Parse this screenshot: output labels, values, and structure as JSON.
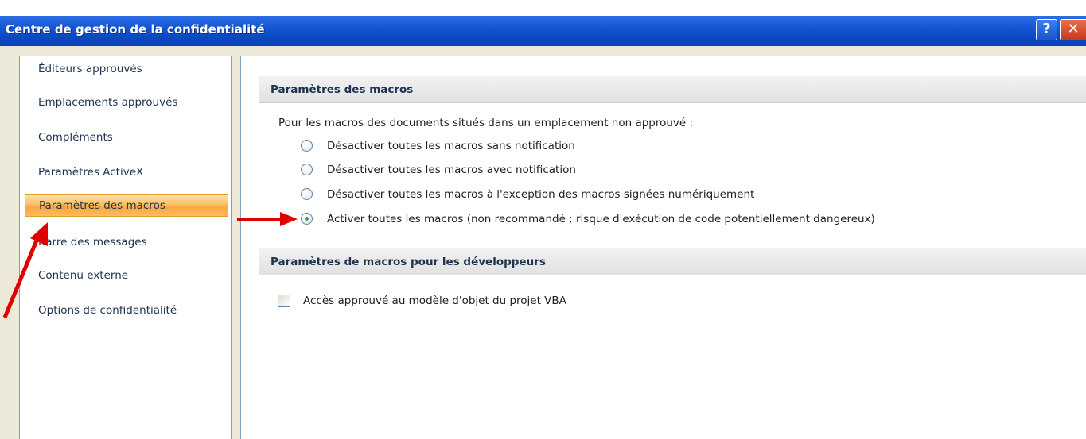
{
  "window": {
    "title": "Centre de gestion de la confidentialité",
    "help_glyph": "?",
    "close_glyph": "✕"
  },
  "nav": {
    "items": [
      {
        "label": "Éditeurs approuvés",
        "selected": false
      },
      {
        "label": "Emplacements approuvés",
        "selected": false
      },
      {
        "label": "Compléments",
        "selected": false
      },
      {
        "label": "Paramètres ActiveX",
        "selected": false
      },
      {
        "label": "Paramètres des macros",
        "selected": true
      },
      {
        "label": "Barre des messages",
        "selected": false
      },
      {
        "label": "Contenu externe",
        "selected": false
      },
      {
        "label": "Options de confidentialité",
        "selected": false
      }
    ]
  },
  "macros": {
    "heading": "Paramètres des macros",
    "intro": "Pour les macros des documents situés dans un emplacement non approuvé :",
    "options": [
      {
        "label": "Désactiver toutes les macros sans notification",
        "checked": false
      },
      {
        "label": "Désactiver toutes les macros avec notification",
        "checked": false
      },
      {
        "label": "Désactiver toutes les macros à l'exception des macros signées numériquement",
        "checked": false
      },
      {
        "label": "Activer toutes les macros (non recommandé ; risque d'exécution de code potentiellement dangereux)",
        "checked": true
      }
    ]
  },
  "developer": {
    "heading": "Paramètres de macros pour les développeurs",
    "vba_access_label": "Accès approuvé au modèle d'objet du projet VBA",
    "vba_access_checked": false
  },
  "colors": {
    "title_bar": "#0b49c2",
    "selected_item": "#f9a942",
    "annotation_arrow": "#e00000",
    "radio_dot": "#3aa43a"
  }
}
